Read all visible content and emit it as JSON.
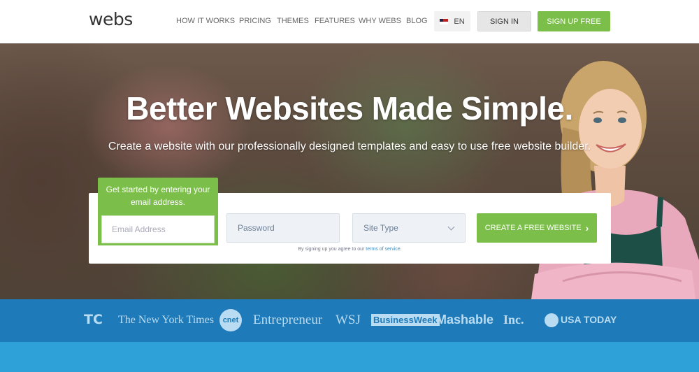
{
  "header": {
    "logo": "webs",
    "nav": [
      "HOW IT WORKS",
      "PRICING",
      "THEMES",
      "FEATURES",
      "WHY WEBS",
      "BLOG"
    ],
    "language": "EN",
    "sign_in": "SIGN IN",
    "sign_up": "SIGN UP FREE"
  },
  "hero": {
    "title": "Better Websites Made Simple.",
    "subtitle": "Create a website with our professionally designed templates and easy to use free website builder."
  },
  "form": {
    "prompt": "Get started by entering your email address.",
    "email_placeholder": "Email Address",
    "password_placeholder": "Password",
    "site_type": "Site Type",
    "create_button": "CREATE A FREE WEBSITE",
    "terms_prefix": "By signing up you agree to our",
    "terms_link": "terms of service."
  },
  "press": [
    "TC",
    "The New York Times",
    "cnet",
    "Entrepreneur",
    "WSJ",
    "BusinessWeek",
    "Mashable",
    "Inc.",
    "USA TODAY"
  ],
  "colors": {
    "green": "#7bbf4a",
    "press_bar": "#1e7ab8",
    "bottom_bar": "#2ea1d8"
  }
}
